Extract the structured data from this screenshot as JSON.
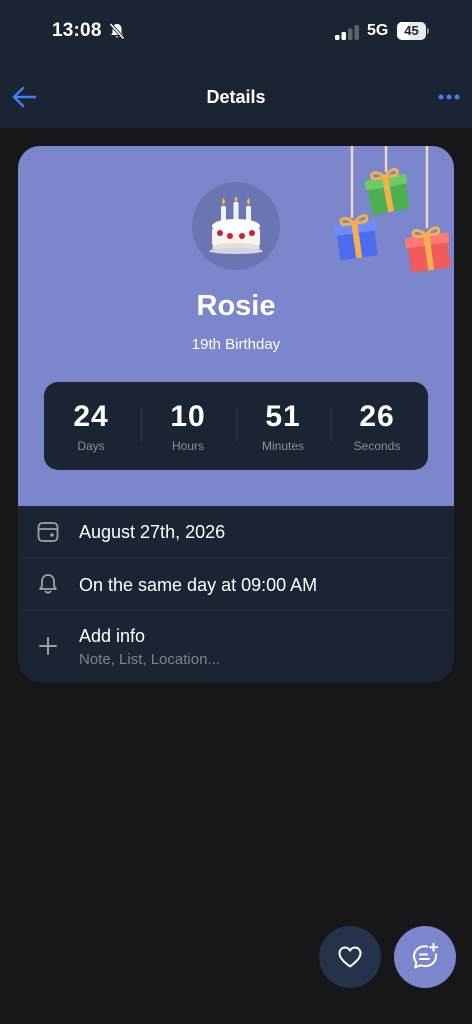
{
  "status_bar": {
    "time": "13:08",
    "network": "5G",
    "battery": "45",
    "battery_level": 0.45,
    "icons": [
      "bell-slash-icon",
      "signal-icon",
      "battery-icon"
    ]
  },
  "nav": {
    "title": "Details",
    "back_icon": "arrow-left-icon",
    "more_icon": "ellipsis-icon"
  },
  "hero": {
    "name": "Rosie",
    "event": "19th Birthday",
    "avatar_icon": "birthday-cake-icon",
    "decoration_icon": "hanging-gifts-icon"
  },
  "countdown": [
    {
      "value": "24",
      "label": "Days"
    },
    {
      "value": "10",
      "label": "Hours"
    },
    {
      "value": "51",
      "label": "Minutes"
    },
    {
      "value": "26",
      "label": "Seconds"
    }
  ],
  "details": {
    "date": "August 27th, 2026",
    "reminder": "On the same day at 09:00 AM",
    "add_info_title": "Add info",
    "add_info_subtitle": "Note, List, Location..."
  },
  "fabs": {
    "favorite_icon": "heart-icon",
    "chat_icon": "chat-add-icon"
  },
  "colors": {
    "accent": "#7b86cc",
    "link": "#3b82f6",
    "card_background": "#1b2432",
    "page_background": "#161719"
  }
}
